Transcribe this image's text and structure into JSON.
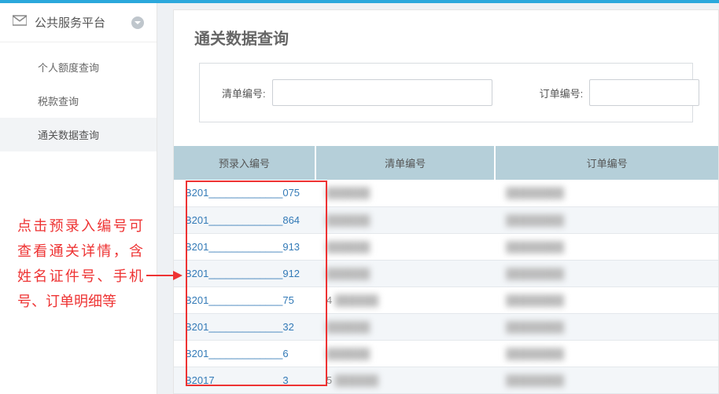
{
  "sidebar": {
    "header": "公共服务平台",
    "items": [
      {
        "label": "个人额度查询",
        "active": false
      },
      {
        "label": "税款查询",
        "active": false
      },
      {
        "label": "通关数据查询",
        "active": true
      }
    ]
  },
  "page": {
    "title": "通关数据查询",
    "filters": {
      "listNoLabel": "清单编号:",
      "listNoValue": "",
      "orderNoLabel": "订单编号:",
      "orderNoValue": ""
    }
  },
  "table": {
    "headers": [
      "预录入编号",
      "清单编号",
      "订单编号"
    ],
    "rows": [
      {
        "pre": "B201_____________075",
        "list": "",
        "order": ""
      },
      {
        "pre": "B201_____________864",
        "list": "",
        "order": ""
      },
      {
        "pre": "B201_____________913",
        "list": "",
        "order": ""
      },
      {
        "pre": "B201_____________912",
        "list": "",
        "order": ""
      },
      {
        "pre": "B201_____________75",
        "list": "4",
        "order": ""
      },
      {
        "pre": "B201_____________32",
        "list": "",
        "order": ""
      },
      {
        "pre": "B201_____________6",
        "list": "",
        "order": ""
      },
      {
        "pre": "B2017____________3",
        "list": "5",
        "order": ""
      }
    ]
  },
  "annotation": {
    "text": "点击预录入编号可查看通关详情，含姓名证件号、手机号、订单明细等"
  }
}
